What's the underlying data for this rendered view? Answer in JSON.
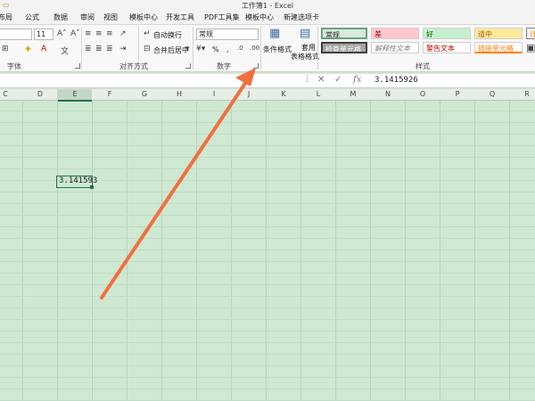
{
  "title_bar": {
    "window_title": "工作簿1 - Excel"
  },
  "menu": {
    "tabs": [
      "布局",
      "公式",
      "数据",
      "审阅",
      "视图",
      "模板中心",
      "开发工具",
      "PDF工具集",
      "模板中心",
      "新建选项卡"
    ]
  },
  "ribbon": {
    "font_size": "11",
    "wrap_text_label": "自动换行",
    "merge_center_label": "合并后居中",
    "number_format": "常规",
    "percent_label": "%",
    "comma_label": ",",
    "cond_format_label": "条件格式",
    "table_format_label_1": "套用",
    "table_format_label_2": "表格格式",
    "groups": {
      "font": "字体",
      "alignment": "对齐方式",
      "number": "数字",
      "styles": "样式"
    },
    "styles": {
      "normal": "常规",
      "bad": "差",
      "good": "好",
      "neutral": "适中",
      "calc": "计",
      "check_cell": "检查单元格",
      "explanatory": "解释性文本",
      "warning": "警告文本",
      "linked_cell": "链接单元格"
    }
  },
  "formula_bar": {
    "value": "3.1415926",
    "fx": "fx"
  },
  "columns": [
    "C",
    "D",
    "E",
    "F",
    "G",
    "H",
    "I",
    "J",
    "K",
    "L",
    "M",
    "N",
    "O",
    "P",
    "Q",
    "R"
  ],
  "selected_column": "E",
  "active_cell": {
    "display": "3.141593"
  },
  "annotation": {
    "color": "#f07040"
  }
}
